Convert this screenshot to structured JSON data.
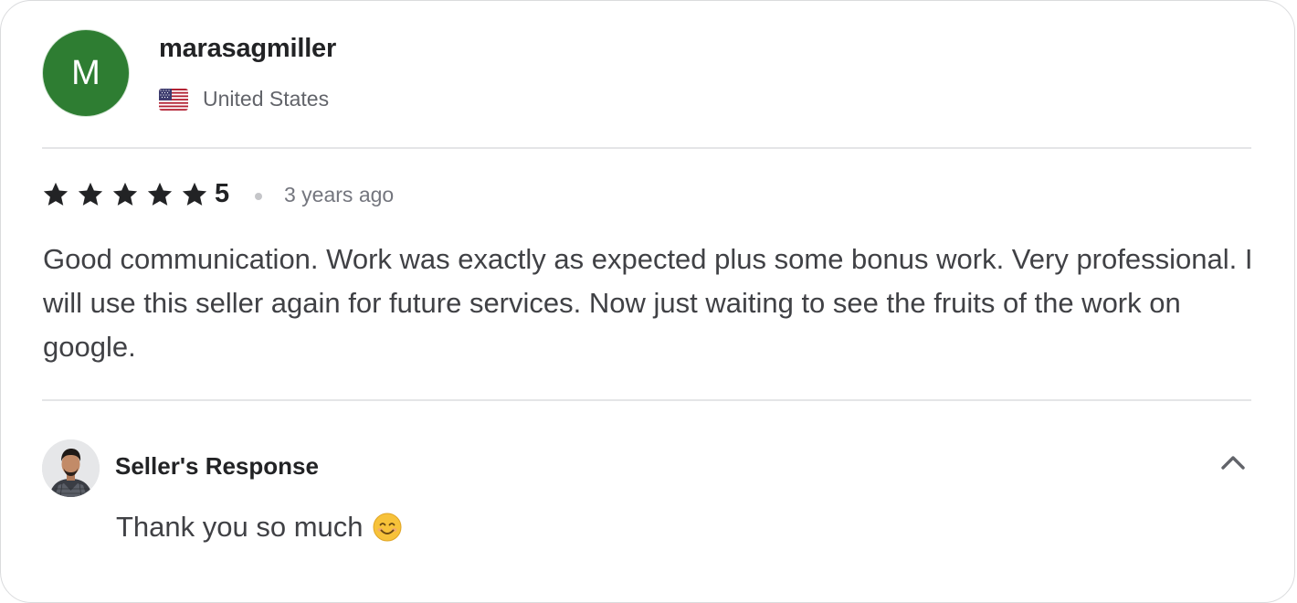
{
  "reviewer": {
    "initial": "M",
    "avatar_color": "#2e7d32",
    "username": "marasagmiller",
    "country": "United States",
    "flag_icon": "us-flag-icon"
  },
  "review": {
    "stars": 5,
    "rating": "5",
    "time_ago": "3 years ago",
    "text": "Good communication. Work was exactly as expected plus some bonus work. Very professional. I will use this seller again for future services. Now just waiting to see the fruits of the work on google."
  },
  "seller_response": {
    "title": "Seller's Response",
    "reply_text": "Thank you so much",
    "reply_emoji": "smiling-face-icon",
    "toggle_icon": "chevron-up-icon"
  },
  "colors": {
    "star": "#222325",
    "text": "#404145",
    "muted": "#74767e",
    "divider": "#e4e5e7"
  }
}
